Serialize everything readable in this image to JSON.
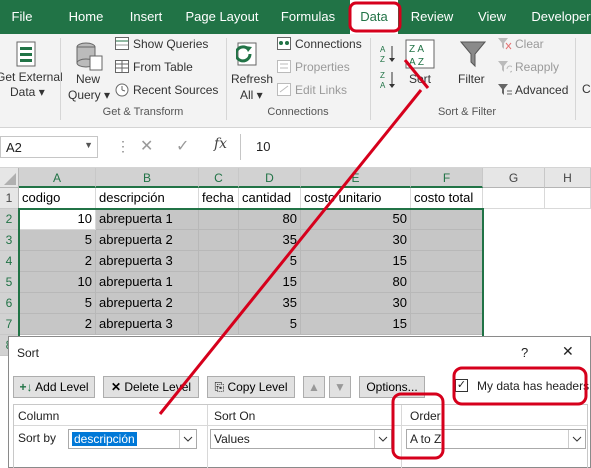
{
  "colors": {
    "accent": "#217346",
    "annotation_red": "#d6001c",
    "selection": "#c6c6c6"
  },
  "ribbon_tabs": [
    "File",
    "Home",
    "Insert",
    "Page Layout",
    "Formulas",
    "Data",
    "Review",
    "View",
    "Developer"
  ],
  "active_tab": "Data",
  "ribbon": {
    "get_external_data": {
      "line1": "Get External",
      "line2": "Data"
    },
    "new_query": {
      "line1": "New",
      "line2": "Query"
    },
    "show_queries": "Show Queries",
    "from_table": "From Table",
    "recent_sources": "Recent Sources",
    "group_get_transform": "Get & Transform",
    "refresh_all": {
      "line1": "Refresh",
      "line2": "All"
    },
    "connections": "Connections",
    "properties": "Properties",
    "edit_links": "Edit Links",
    "group_connections": "Connections",
    "sort": "Sort",
    "filter": "Filter",
    "clear": "Clear",
    "reapply": "Reapply",
    "advanced": "Advanced",
    "group_sort_filter": "Sort & Filter",
    "edge_letter": "C"
  },
  "formula_bar": {
    "name_box": "A2",
    "fx": "fx",
    "value": "10"
  },
  "sheet": {
    "columns": [
      "A",
      "B",
      "C",
      "D",
      "E",
      "F",
      "G",
      "H"
    ],
    "row_numbers": [
      "1",
      "2",
      "3",
      "4",
      "5",
      "6",
      "7",
      "8"
    ],
    "headers": [
      "codigo",
      "descripción",
      "fecha",
      "cantidad",
      "costo unitario",
      "costo total"
    ],
    "rows": [
      [
        "10",
        "abrepuerta 1",
        "",
        "80",
        "50",
        ""
      ],
      [
        "5",
        "abrepuerta 2",
        "",
        "35",
        "30",
        ""
      ],
      [
        "2",
        "abrepuerta 3",
        "",
        "5",
        "15",
        ""
      ],
      [
        "10",
        "abrepuerta 1",
        "",
        "15",
        "80",
        ""
      ],
      [
        "5",
        "abrepuerta 2",
        "",
        "35",
        "30",
        ""
      ],
      [
        "2",
        "abrepuerta 3",
        "",
        "5",
        "15",
        ""
      ]
    ]
  },
  "sort_dialog": {
    "title": "Sort",
    "help": "?",
    "close": "✕",
    "add_level": "Add Level",
    "delete_level": "Delete Level",
    "copy_level": "Copy Level",
    "options": "Options...",
    "my_data_has_headers": "My data has headers",
    "headers_checked": true,
    "col_header_column": "Column",
    "col_header_sort_on": "Sort On",
    "col_header_order": "Order",
    "sort_by_label": "Sort by",
    "sort_by_value": "descripción",
    "sort_on_value": "Values",
    "order_value": "A to Z"
  }
}
